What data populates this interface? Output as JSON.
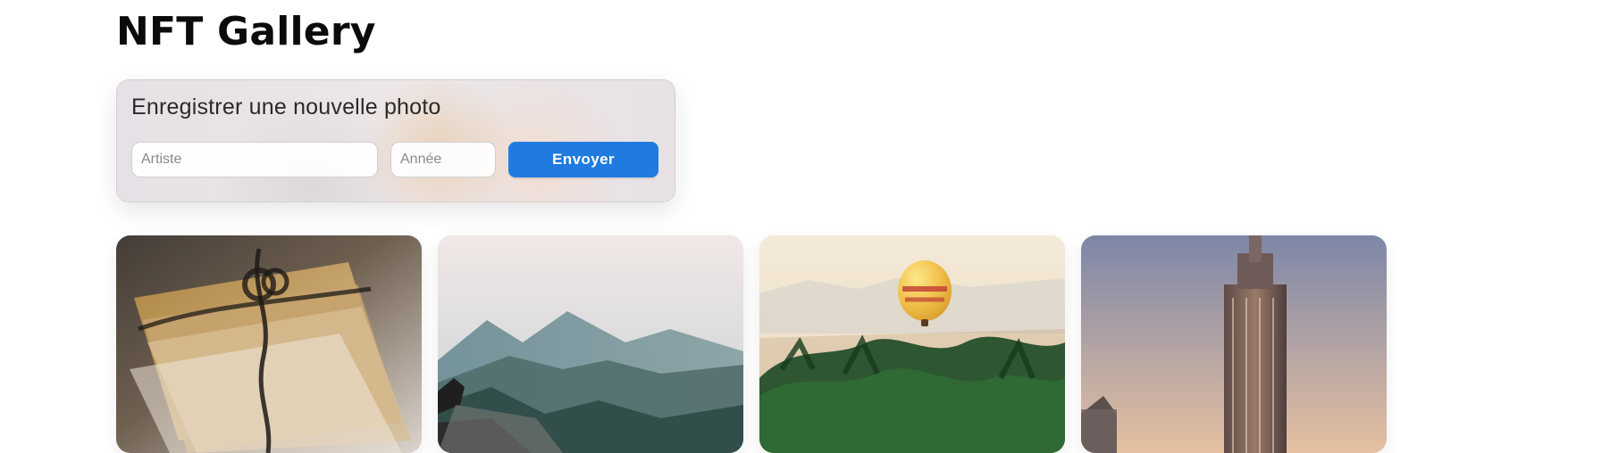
{
  "page": {
    "title": "NFT Gallery"
  },
  "form": {
    "title": "Enregistrer une nouvelle photo",
    "artist_placeholder": "Artiste",
    "year_placeholder": "Année",
    "submit_label": "Envoyer",
    "accent": "#1f7be0"
  },
  "gallery": {
    "items": [
      {
        "name": "photo-letters",
        "icon": "photo-icon"
      },
      {
        "name": "photo-mountain",
        "icon": "photo-icon"
      },
      {
        "name": "photo-balloon",
        "icon": "photo-icon"
      },
      {
        "name": "photo-building",
        "icon": "photo-icon"
      }
    ]
  }
}
